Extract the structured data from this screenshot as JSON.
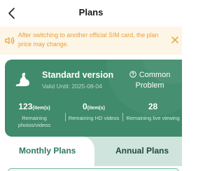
{
  "header": {
    "title": "Plans"
  },
  "notice": {
    "text": "After switching to another official SIM card, the plan price may change."
  },
  "plan_card": {
    "name": "Standard version",
    "valid_until": "Valid Until:  2025-08-04",
    "help_text": "Common Problem",
    "stats": [
      {
        "value": "123",
        "unit": "(item(s)",
        "label": "Remaining photos/videos"
      },
      {
        "value": "0",
        "unit": "(item(s)",
        "label": "Remaining HD videos"
      },
      {
        "value": "28",
        "unit": "",
        "label": "Remaining live viewing"
      }
    ]
  },
  "tabs": [
    {
      "label": "Monthly Plans",
      "active": true
    },
    {
      "label": "Annual Plans",
      "active": false
    }
  ],
  "colors": {
    "accent": "#3f8b6b",
    "notice_text": "#e5a23a",
    "notice_bg": "#fdf5e6"
  }
}
